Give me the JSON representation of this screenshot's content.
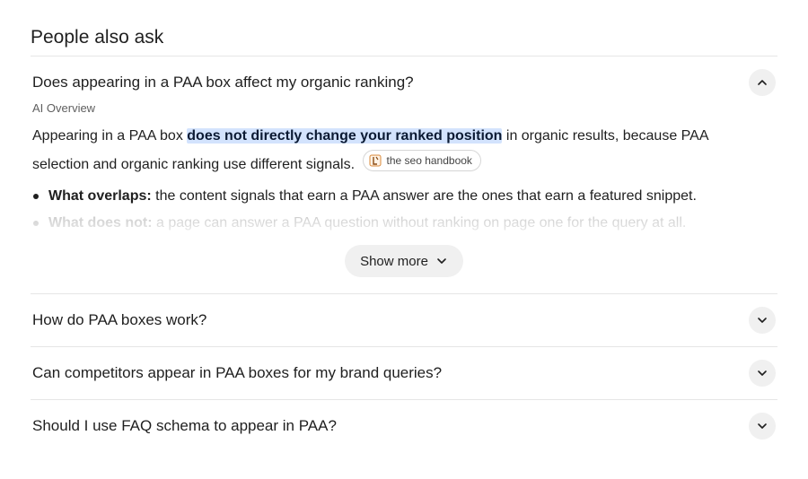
{
  "section": {
    "title": "People also ask"
  },
  "expanded": {
    "question": "Does appearing in a PAA box affect my organic ranking?",
    "ai_label": "AI Overview",
    "answer": {
      "before": "Appearing in a PAA box ",
      "highlight": "does not directly change your ranked position",
      "after": " in organic results, because PAA selection and organic ranking use different signals."
    },
    "source_chip": "the seo handbook",
    "bullets": [
      {
        "term": "What overlaps:",
        "text": " the content signals that earn a PAA answer are the ones that earn a featured snippet."
      },
      {
        "term": "What does not:",
        "text": " a page can answer a PAA question without ranking on page one for the query at all."
      }
    ],
    "show_more": "Show more"
  },
  "questions": [
    {
      "text": "How do PAA boxes work?"
    },
    {
      "text": "Can competitors appear in PAA boxes for my brand queries?"
    },
    {
      "text": "Should I use FAQ schema to appear in PAA?"
    }
  ],
  "icons": {
    "collapse": "chevron-up-icon",
    "expand": "chevron-down-icon",
    "source": "source-favicon"
  },
  "colors": {
    "highlight": "#d3e3fd",
    "button_bg": "#f0f0f0",
    "divider": "#e6e6e6"
  }
}
